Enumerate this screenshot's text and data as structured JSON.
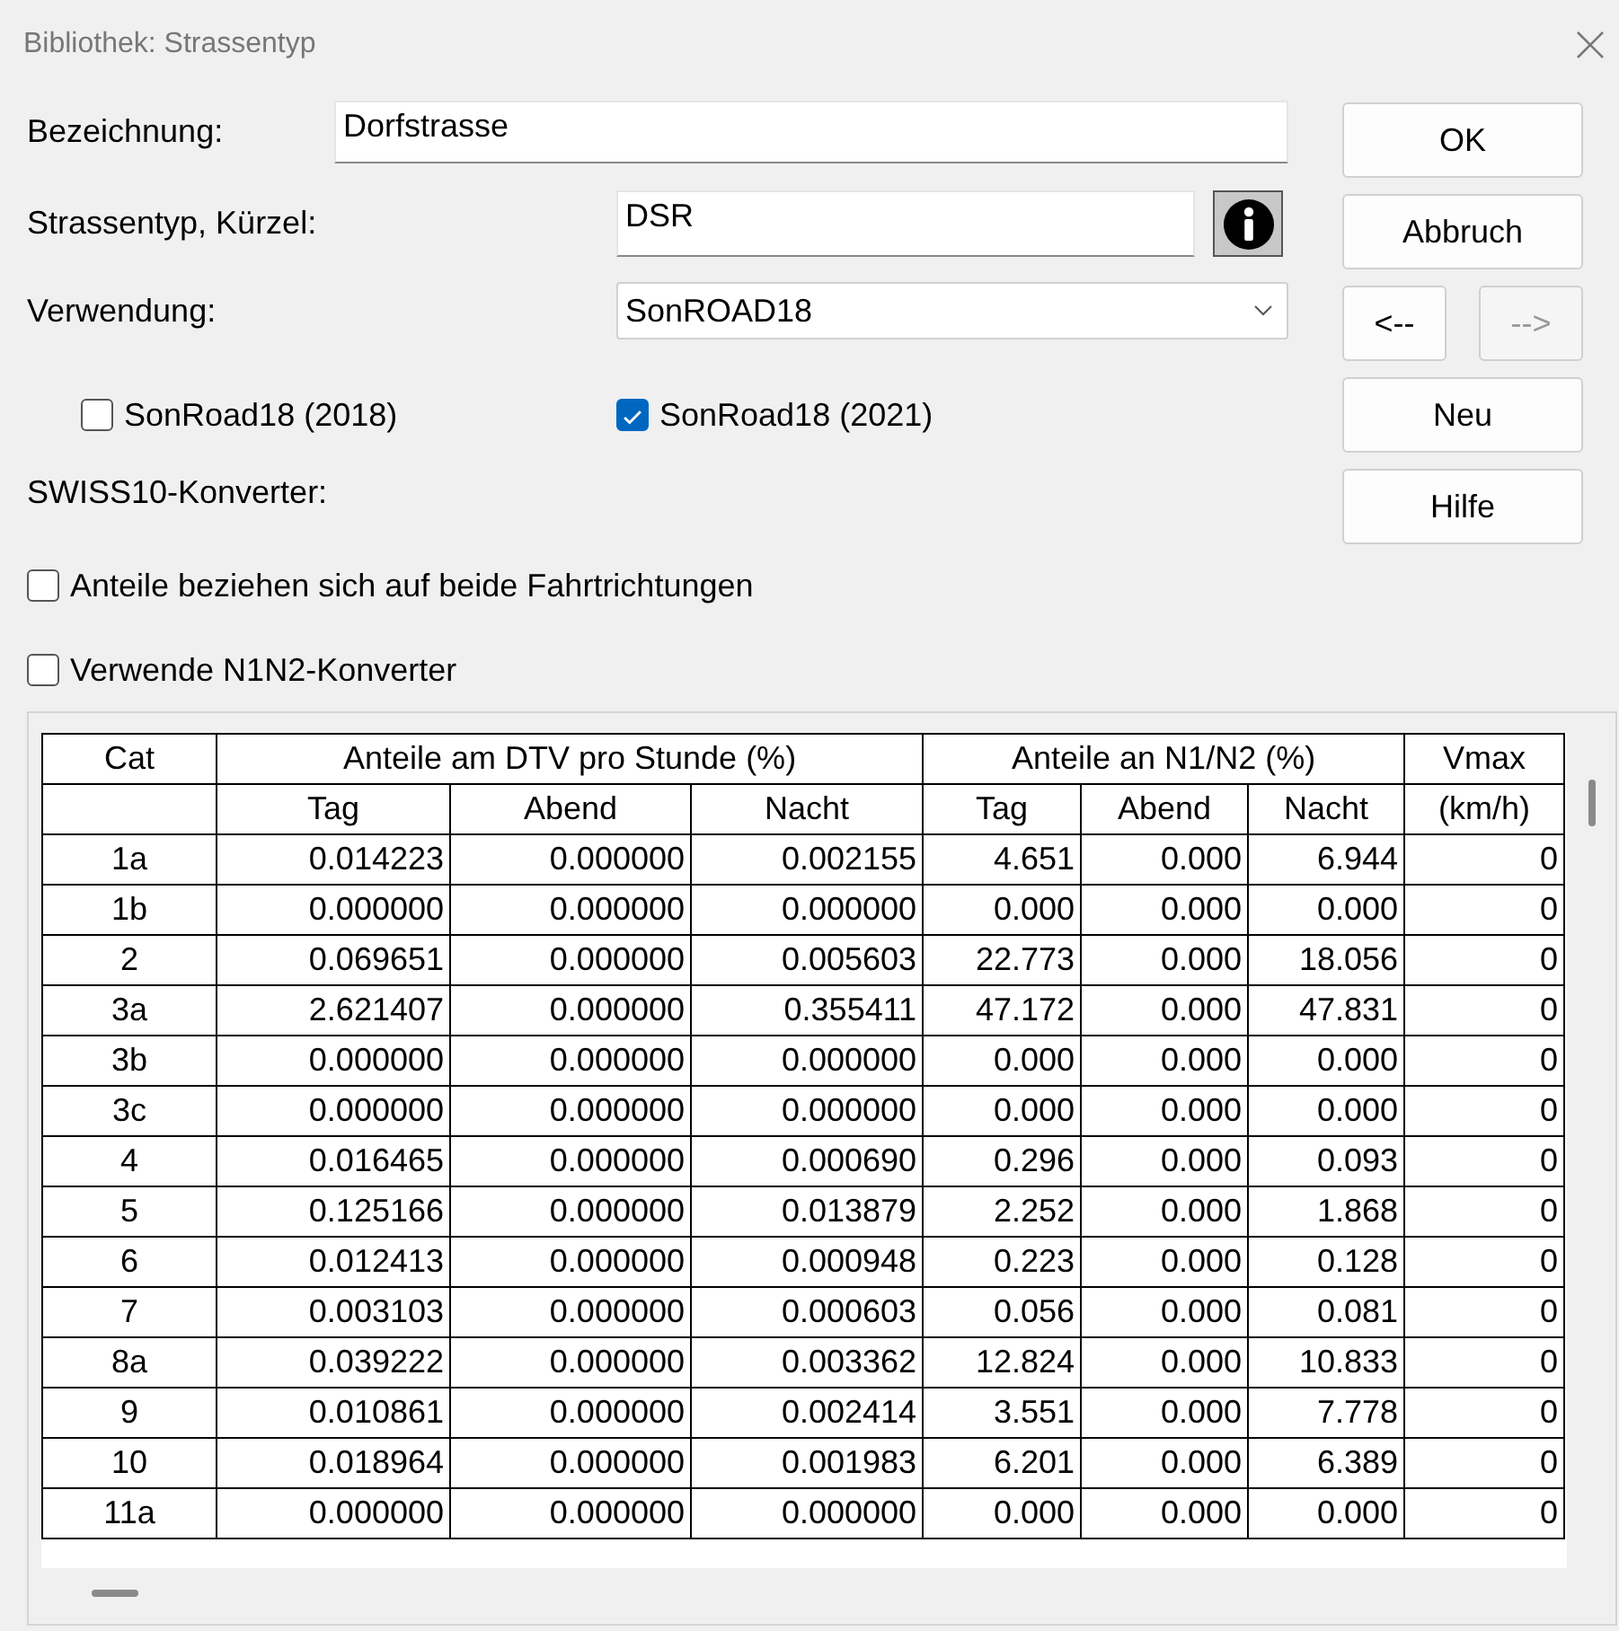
{
  "window": {
    "title": "Bibliothek: Strassentyp"
  },
  "fields": {
    "bezeichnung": {
      "label": "Bezeichnung:",
      "value": "Dorfstrasse"
    },
    "kuerzel": {
      "label": "Strassentyp, Kürzel:",
      "value": "DSR"
    },
    "verwendung": {
      "label": "Verwendung:",
      "value": "SonROAD18"
    }
  },
  "versions": [
    {
      "label": "SonRoad18 (2018)",
      "checked": false
    },
    {
      "label": "SonRoad18 (2021)",
      "checked": true
    }
  ],
  "swiss10_label": "SWISS10-Konverter:",
  "options": [
    {
      "label": "Anteile beziehen sich auf beide Fahrtrichtungen",
      "checked": false
    },
    {
      "label": "Verwende N1N2-Konverter",
      "checked": false
    }
  ],
  "buttons": {
    "ok": {
      "label": "OK",
      "disabled": false
    },
    "abbruch": {
      "label": "Abbruch",
      "disabled": false
    },
    "prev": {
      "label": "<--",
      "disabled": false
    },
    "next": {
      "label": "-->",
      "disabled": true
    },
    "neu": {
      "label": "Neu",
      "disabled": false
    },
    "hilfe": {
      "label": "Hilfe",
      "disabled": false
    }
  },
  "table": {
    "first_column": "Cat",
    "groups": [
      {
        "label": "Anteile am DTV pro Stunde (%)",
        "columns": [
          "Tag",
          "Abend",
          "Nacht"
        ]
      },
      {
        "label": "Anteile an N1/N2 (%)",
        "columns": [
          "Tag",
          "Abend",
          "Nacht"
        ]
      },
      {
        "label": "Vmax",
        "columns": [
          "(km/h)"
        ]
      }
    ],
    "rows": [
      [
        "1a",
        "0.014223",
        "0.000000",
        "0.002155",
        "4.651",
        "0.000",
        "6.944",
        "0"
      ],
      [
        "1b",
        "0.000000",
        "0.000000",
        "0.000000",
        "0.000",
        "0.000",
        "0.000",
        "0"
      ],
      [
        "2",
        "0.069651",
        "0.000000",
        "0.005603",
        "22.773",
        "0.000",
        "18.056",
        "0"
      ],
      [
        "3a",
        "2.621407",
        "0.000000",
        "0.355411",
        "47.172",
        "0.000",
        "47.831",
        "0"
      ],
      [
        "3b",
        "0.000000",
        "0.000000",
        "0.000000",
        "0.000",
        "0.000",
        "0.000",
        "0"
      ],
      [
        "3c",
        "0.000000",
        "0.000000",
        "0.000000",
        "0.000",
        "0.000",
        "0.000",
        "0"
      ],
      [
        "4",
        "0.016465",
        "0.000000",
        "0.000690",
        "0.296",
        "0.000",
        "0.093",
        "0"
      ],
      [
        "5",
        "0.125166",
        "0.000000",
        "0.013879",
        "2.252",
        "0.000",
        "1.868",
        "0"
      ],
      [
        "6",
        "0.012413",
        "0.000000",
        "0.000948",
        "0.223",
        "0.000",
        "0.128",
        "0"
      ],
      [
        "7",
        "0.003103",
        "0.000000",
        "0.000603",
        "0.056",
        "0.000",
        "0.081",
        "0"
      ],
      [
        "8a",
        "0.039222",
        "0.000000",
        "0.003362",
        "12.824",
        "0.000",
        "10.833",
        "0"
      ],
      [
        "9",
        "0.010861",
        "0.000000",
        "0.002414",
        "3.551",
        "0.000",
        "7.778",
        "0"
      ],
      [
        "10",
        "0.018964",
        "0.000000",
        "0.001983",
        "6.201",
        "0.000",
        "6.389",
        "0"
      ],
      [
        "11a",
        "0.000000",
        "0.000000",
        "0.000000",
        "0.000",
        "0.000",
        "0.000",
        "0"
      ]
    ]
  }
}
